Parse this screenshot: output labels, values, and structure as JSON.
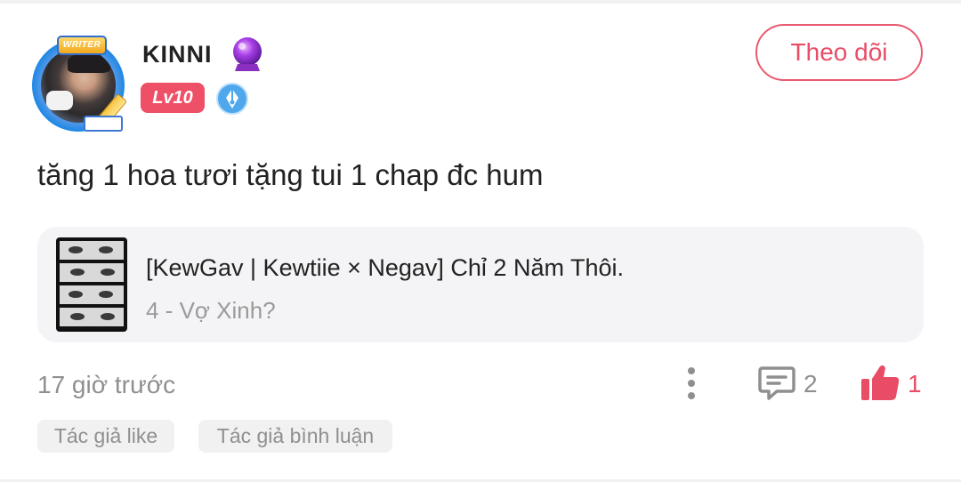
{
  "comment": {
    "author": {
      "name": "KINNI",
      "avatar_badge": "WRITER",
      "level": "Lv10",
      "icons": [
        "crystal-ball-icon",
        "pen-nib-badge-icon"
      ]
    },
    "follow_label": "Theo dõi",
    "text": "tăng 1 hoa tươi tặng tui 1 chap đc hum",
    "story": {
      "title": "[KewGav | Kewtiie × Negav] Chỉ 2 Năm Thôi.",
      "chapter": "4 - Vợ Xinh?"
    },
    "timestamp": "17 giờ trước",
    "reply_count": "2",
    "like_count": "1",
    "tags": {
      "author_like": "Tác giả like",
      "author_comment": "Tác giả bình luận"
    }
  },
  "colors": {
    "accent": "#e84d65",
    "level_badge": "#ee5068",
    "card_background": "#f4f4f6",
    "muted_text": "#8f8f8f"
  }
}
